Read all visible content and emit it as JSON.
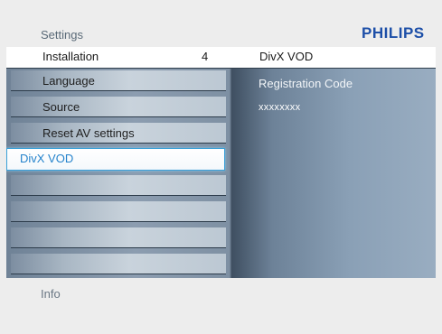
{
  "top": {
    "title": "Settings",
    "brand": "PHILIPS"
  },
  "header": {
    "left": "Installation",
    "number": "4",
    "right": "DivX VOD"
  },
  "menu": {
    "items": [
      {
        "label": "Language",
        "selected": false
      },
      {
        "label": "Source",
        "selected": false
      },
      {
        "label": "Reset AV settings",
        "selected": false
      },
      {
        "label": "DivX VOD",
        "selected": true
      },
      {
        "label": "",
        "selected": false
      },
      {
        "label": "",
        "selected": false
      },
      {
        "label": "",
        "selected": false
      },
      {
        "label": "",
        "selected": false
      }
    ]
  },
  "detail": {
    "label": "Registration Code",
    "value": "xxxxxxxx"
  },
  "footer": {
    "info": "Info"
  },
  "colors": {
    "brand": "#1d4fa8",
    "highlight": "#3aa0d8",
    "panel": "#8c9db0"
  }
}
